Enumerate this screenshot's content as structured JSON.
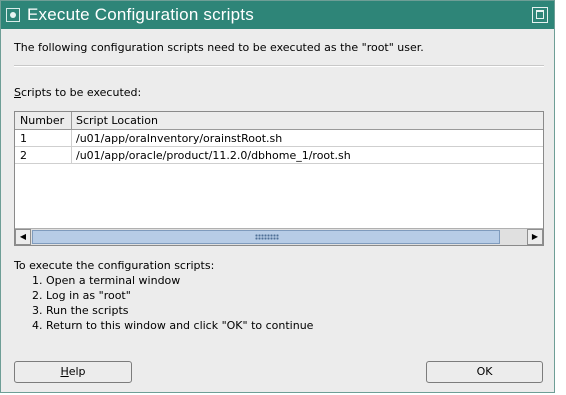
{
  "window": {
    "title": "Execute Configuration scripts"
  },
  "message": "The following configuration scripts need to be executed as the \"root\" user.",
  "scripts_label": {
    "mnemonic": "S",
    "rest": "cripts to be executed:"
  },
  "table": {
    "columns": [
      "Number",
      "Script Location"
    ],
    "rows": [
      {
        "number": "1",
        "location": "/u01/app/oraInventory/orainstRoot.sh"
      },
      {
        "number": "2",
        "location": "/u01/app/oracle/product/11.2.0/dbhome_1/root.sh"
      }
    ]
  },
  "instructions": {
    "heading": "To execute the configuration scripts:",
    "steps": [
      "1. Open a terminal window",
      "2. Log in as \"root\"",
      "3. Run the scripts",
      "4. Return to this window and click \"OK\" to continue"
    ]
  },
  "buttons": {
    "help_mnemonic": "H",
    "help_rest": "elp",
    "ok": "OK"
  },
  "icons": {
    "window": "window-menu-icon",
    "maximize": "maximize-icon",
    "scroll_left": "arrow-left-icon",
    "scroll_right": "arrow-right-icon"
  },
  "colors": {
    "titlebar": "#2e8578",
    "dialog_bg": "#ececec",
    "scroll_thumb": "#b7cce6"
  }
}
